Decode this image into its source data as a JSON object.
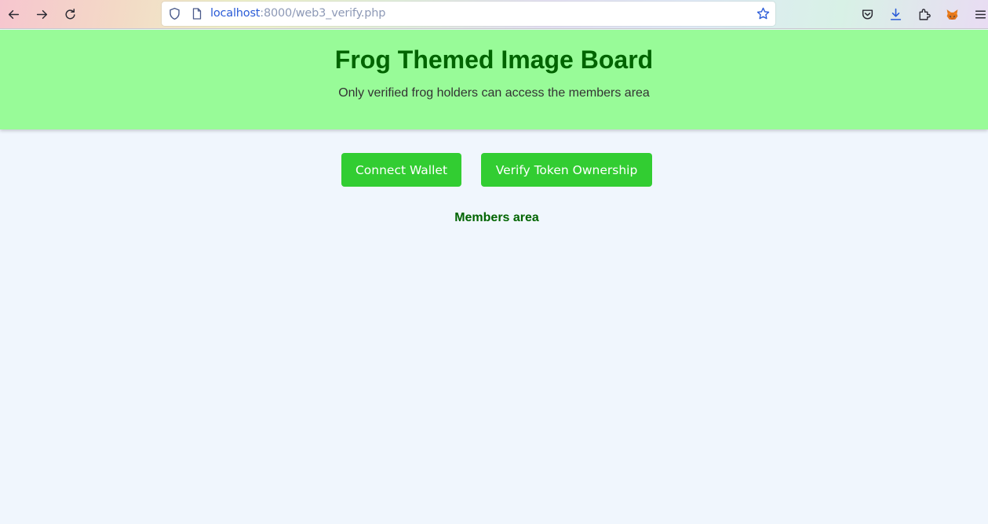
{
  "browser": {
    "url_host": "localhost",
    "url_rest": ":8000/web3_verify.php"
  },
  "header": {
    "title": "Frog Themed Image Board",
    "subtitle": "Only verified frog holders can access the members area"
  },
  "actions": {
    "connect_label": "Connect Wallet",
    "verify_label": "Verify Token Ownership"
  },
  "members": {
    "label": "Members area"
  },
  "colors": {
    "header_bg": "#98fb98",
    "title": "#006400",
    "button": "#32cd32",
    "page_bg": "#f0f6fd"
  },
  "icons": {
    "back": "back-arrow-icon",
    "forward": "forward-arrow-icon",
    "reload": "reload-icon",
    "shield": "tracking-shield-icon",
    "page": "page-icon",
    "bookmark": "bookmark-star-icon",
    "pocket": "pocket-icon",
    "downloads": "download-icon",
    "extensions": "extensions-icon",
    "metamask": "metamask-fox-icon",
    "menu": "hamburger-menu-icon"
  }
}
